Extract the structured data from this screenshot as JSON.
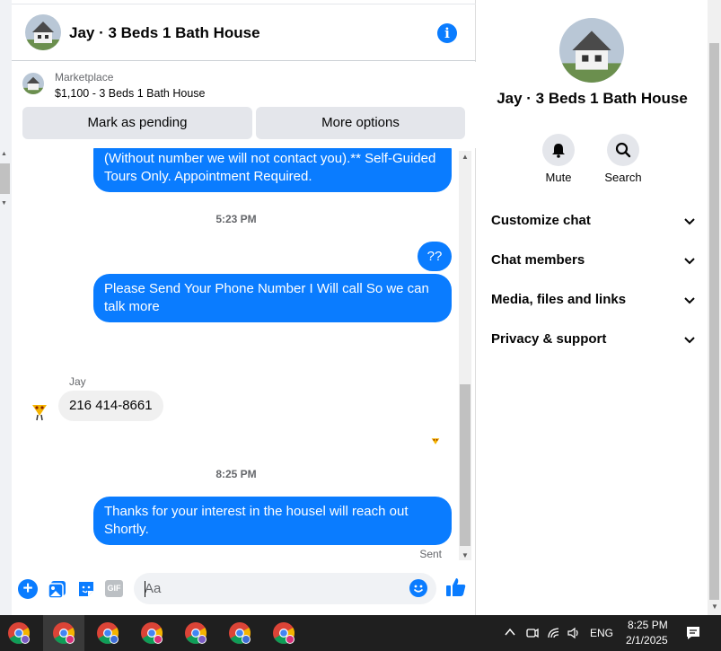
{
  "header": {
    "title": "Jay · 3 Beds 1 Bath House"
  },
  "listing": {
    "label": "Marketplace",
    "price_title": "$1,100 - 3 Beds 1 Bath House",
    "mark_pending": "Mark as pending",
    "more_options": "More options"
  },
  "messages": {
    "m1": "(Without number we will not contact you).** Self-Guided Tours Only. Appointment Required.",
    "ts1": "5:23 PM",
    "m2": "??",
    "m3": "Please Send Your Phone Number I Will call So we can talk more",
    "sender": "Jay",
    "m4": "216 414-8661",
    "ts2": "8:25 PM",
    "m5": "Thanks for your interest in the housel will reach out Shortly.",
    "status": "Sent"
  },
  "composer": {
    "placeholder": "Aa",
    "gif_label": "GIF"
  },
  "panel": {
    "name": "Jay · 3 Beds 1 Bath House",
    "actions": {
      "mute": "Mute",
      "search": "Search"
    },
    "sections": [
      "Customize chat",
      "Chat members",
      "Media, files and links",
      "Privacy & support"
    ]
  },
  "taskbar": {
    "language": "ENG",
    "time": "8:25 PM",
    "date": "2/1/2025"
  },
  "colors": {
    "accent": "#0a7cff",
    "taskbar": "#1f1f1f"
  }
}
